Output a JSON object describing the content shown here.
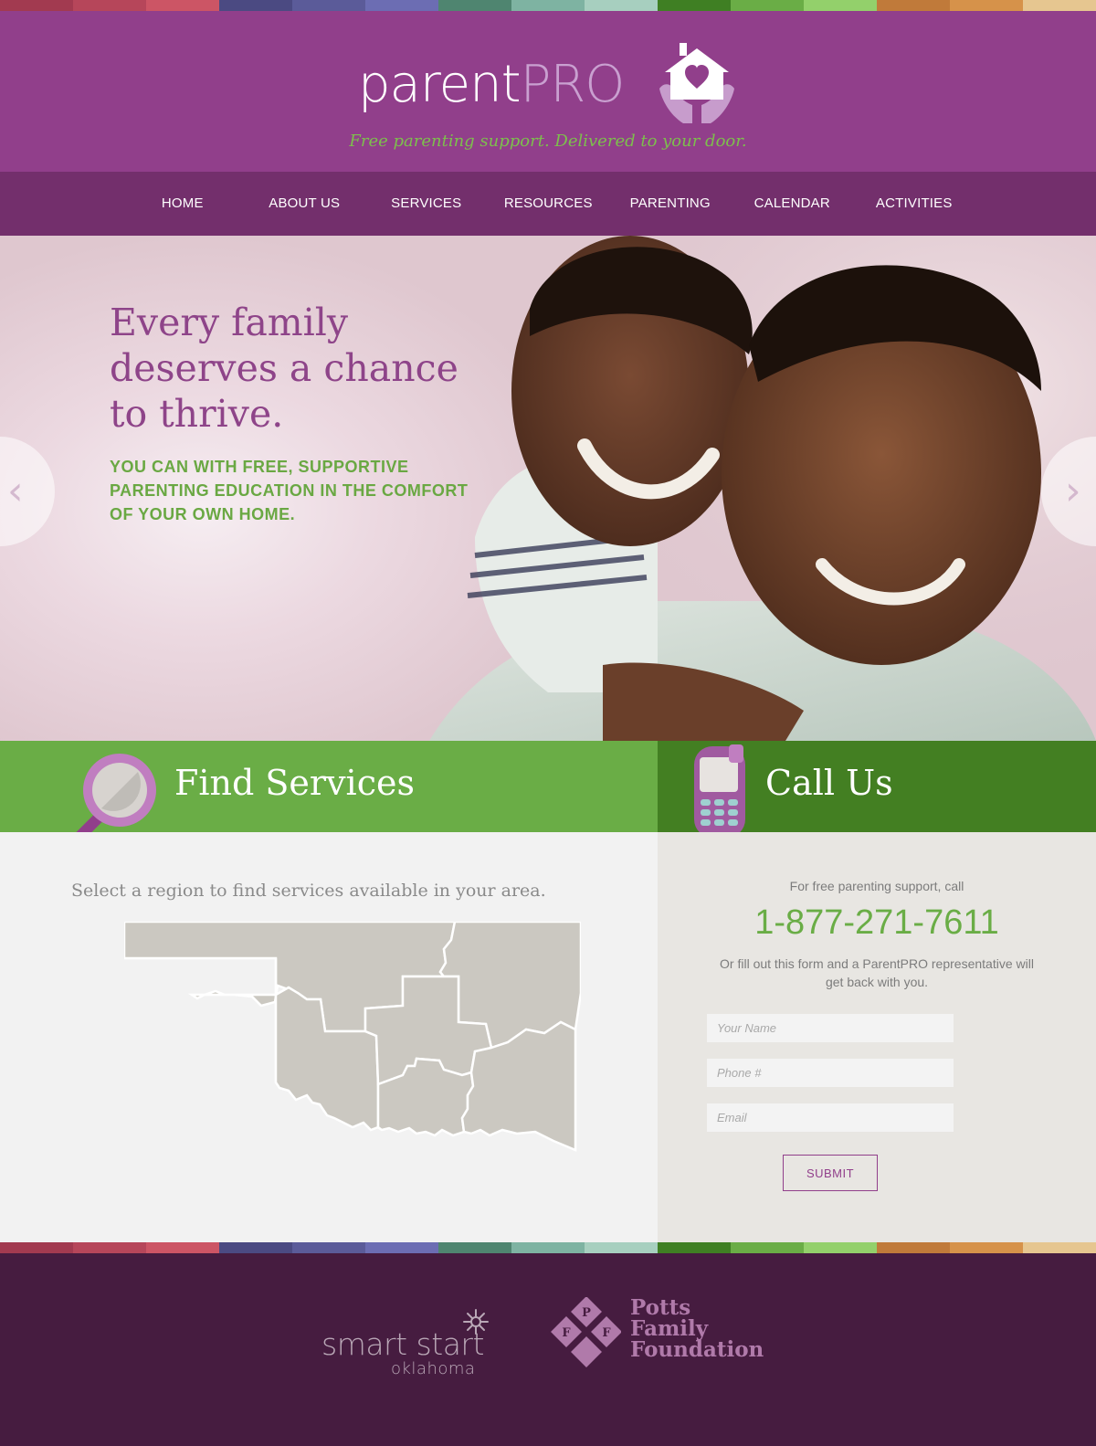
{
  "brand": {
    "name_part1": "parent",
    "name_part2": "PRO",
    "tagline": "Free parenting support. Delivered to your door.",
    "logo_icon": "house-heart-hands-icon"
  },
  "stripe_colors": [
    "#a23a50",
    "#b6465a",
    "#cc5565",
    "#4b4a82",
    "#5b5b99",
    "#6c6db3",
    "#4f8570",
    "#7eb3a2",
    "#a7cfbf",
    "#3f7f23",
    "#6aad46",
    "#93d06b",
    "#c07a3a",
    "#d6924a",
    "#e6c690"
  ],
  "nav": {
    "items": [
      "HOME",
      "ABOUT US",
      "SERVICES",
      "RESOURCES",
      "PARENTING",
      "CALENDAR",
      "ACTIVITIES"
    ]
  },
  "hero": {
    "title": "Every family deserves a chance to thrive.",
    "subtitle": "YOU CAN WITH FREE, SUPPORTIVE PARENTING EDUCATION IN THE COMFORT OF YOUR OWN HOME.",
    "prev_icon": "chevron-left-icon",
    "next_icon": "chevron-right-icon"
  },
  "find": {
    "title": "Find Services",
    "icon": "magnifying-glass-icon",
    "intro": "Select a region to find services available in your area.",
    "map_icon": "oklahoma-region-map"
  },
  "call": {
    "title": "Call Us",
    "icon": "cell-phone-icon",
    "intro": "For free parenting support, call",
    "phone": "1-877-271-7611",
    "text": "Or fill out this form and a ParentPRO representative will get back with you.",
    "form": {
      "name_placeholder": "Your Name",
      "phone_placeholder": "Phone #",
      "email_placeholder": "Email",
      "submit_label": "SUBMIT"
    }
  },
  "footer": {
    "smart_start_line1": "smart start",
    "smart_start_line2": "oklahoma",
    "pff_line1": "Potts",
    "pff_line2": "Family",
    "pff_line3": "Foundation",
    "pff_letters": [
      "P",
      "F",
      "F"
    ]
  },
  "colors": {
    "purple": "#913f8b",
    "nav_purple": "#732f6c",
    "green": "#6aad46",
    "dark_green": "#437f22",
    "footer": "#461c40"
  }
}
